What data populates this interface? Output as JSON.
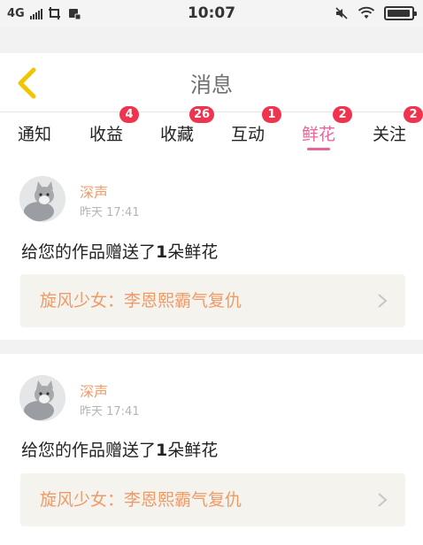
{
  "status_bar": {
    "network": "4G",
    "time": "10:07",
    "icons": [
      "signal-icon",
      "screenshot-icon",
      "sim-icon",
      "mute-icon",
      "wifi-icon",
      "battery-icon"
    ],
    "battery_level": 0.95
  },
  "header": {
    "title": "消息",
    "back_icon": "chevron-left-icon",
    "accent_color": "#f2c500"
  },
  "tabs": [
    {
      "label": "通知",
      "badge": ""
    },
    {
      "label": "收益",
      "badge": "4"
    },
    {
      "label": "收藏",
      "badge": "26"
    },
    {
      "label": "互动",
      "badge": "1"
    },
    {
      "label": "鲜花",
      "badge": "2",
      "active": true
    },
    {
      "label": "关注",
      "badge": "2"
    }
  ],
  "messages": [
    {
      "username": "深声",
      "timestamp": "昨天 17:41",
      "text_prefix": "给您的作品赠送了",
      "count": "1",
      "text_suffix": "朵鲜花",
      "work_title": "旋风少女：李恩熙霸气复仇"
    },
    {
      "username": "深声",
      "timestamp": "昨天 17:41",
      "text_prefix": "给您的作品赠送了",
      "count": "1",
      "text_suffix": "朵鲜花",
      "work_title": "旋风少女：李恩熙霸气复仇"
    }
  ],
  "colors": {
    "active_tab": "#e8649a",
    "badge": "#f0344d",
    "username": "#f09a66",
    "work_title": "#f09a66"
  }
}
